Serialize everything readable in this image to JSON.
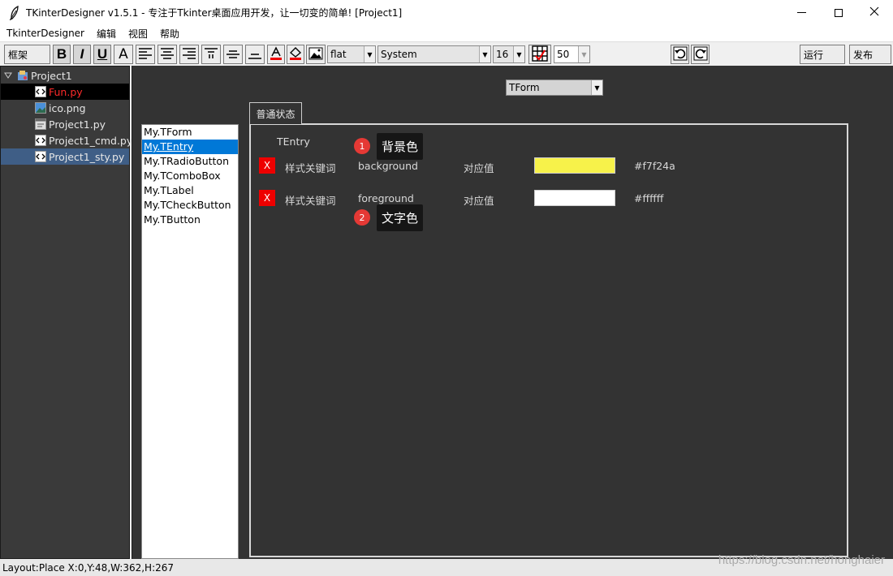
{
  "window": {
    "title": "TKinterDesigner v1.5.1 - 专注于Tkinter桌面应用开发，让一切变的简单!    [Project1]"
  },
  "menu": [
    "TkinterDesigner",
    "编辑",
    "视图",
    "帮助"
  ],
  "toolbar": {
    "frame_label": "框架",
    "bold": "B",
    "italic": "I",
    "underline": "U",
    "font_letter": "A",
    "relief": "flat",
    "font_family": "System",
    "font_size": "16",
    "grid_size": "50",
    "run_label": "运行",
    "publish_label": "发布"
  },
  "tree": {
    "root": "Project1",
    "files": [
      {
        "name": "Fun.py",
        "icon": "python-file-icon",
        "state": "active"
      },
      {
        "name": "ico.png",
        "icon": "image-file-icon",
        "state": "normal"
      },
      {
        "name": "Project1.py",
        "icon": "form-file-icon",
        "state": "normal"
      },
      {
        "name": "Project1_cmd.py",
        "icon": "python-file-icon",
        "state": "normal"
      },
      {
        "name": "Project1_sty.py",
        "icon": "python-file-icon",
        "state": "selected"
      }
    ]
  },
  "form_selector": "TForm",
  "styles": {
    "items": [
      "My.TForm",
      "My.TEntry",
      "My.TRadioButton",
      "My.TComboBox",
      "My.TLabel",
      "My.TCheckButton",
      "My.TButton"
    ],
    "selected_index": 1
  },
  "tab": "普通状态",
  "panel": {
    "class_name": "TEntry",
    "rows": [
      {
        "delete": "X",
        "key_label": "样式关键词",
        "key": "background",
        "value_label": "对应值",
        "color": "#f7f24a",
        "color_text": "#f7f24a"
      },
      {
        "delete": "X",
        "key_label": "样式关键词",
        "key": "foreground",
        "value_label": "对应值",
        "color": "#ffffff",
        "color_text": "#ffffff"
      }
    ]
  },
  "annotations": [
    {
      "number": "1",
      "text": "背景色"
    },
    {
      "number": "2",
      "text": "文字色"
    }
  ],
  "status": "Layout:Place   X:0,Y:48,W:362,H:267",
  "watermark": "https://blog.csdn.net/honghaier",
  "colors": {
    "workspace_bg": "#333333",
    "tree_bg": "#3a3a3a",
    "selection": "#0078d7",
    "delete_red": "#ee0000",
    "active_file": "#ff2a2a",
    "badge_red": "#e53935"
  }
}
